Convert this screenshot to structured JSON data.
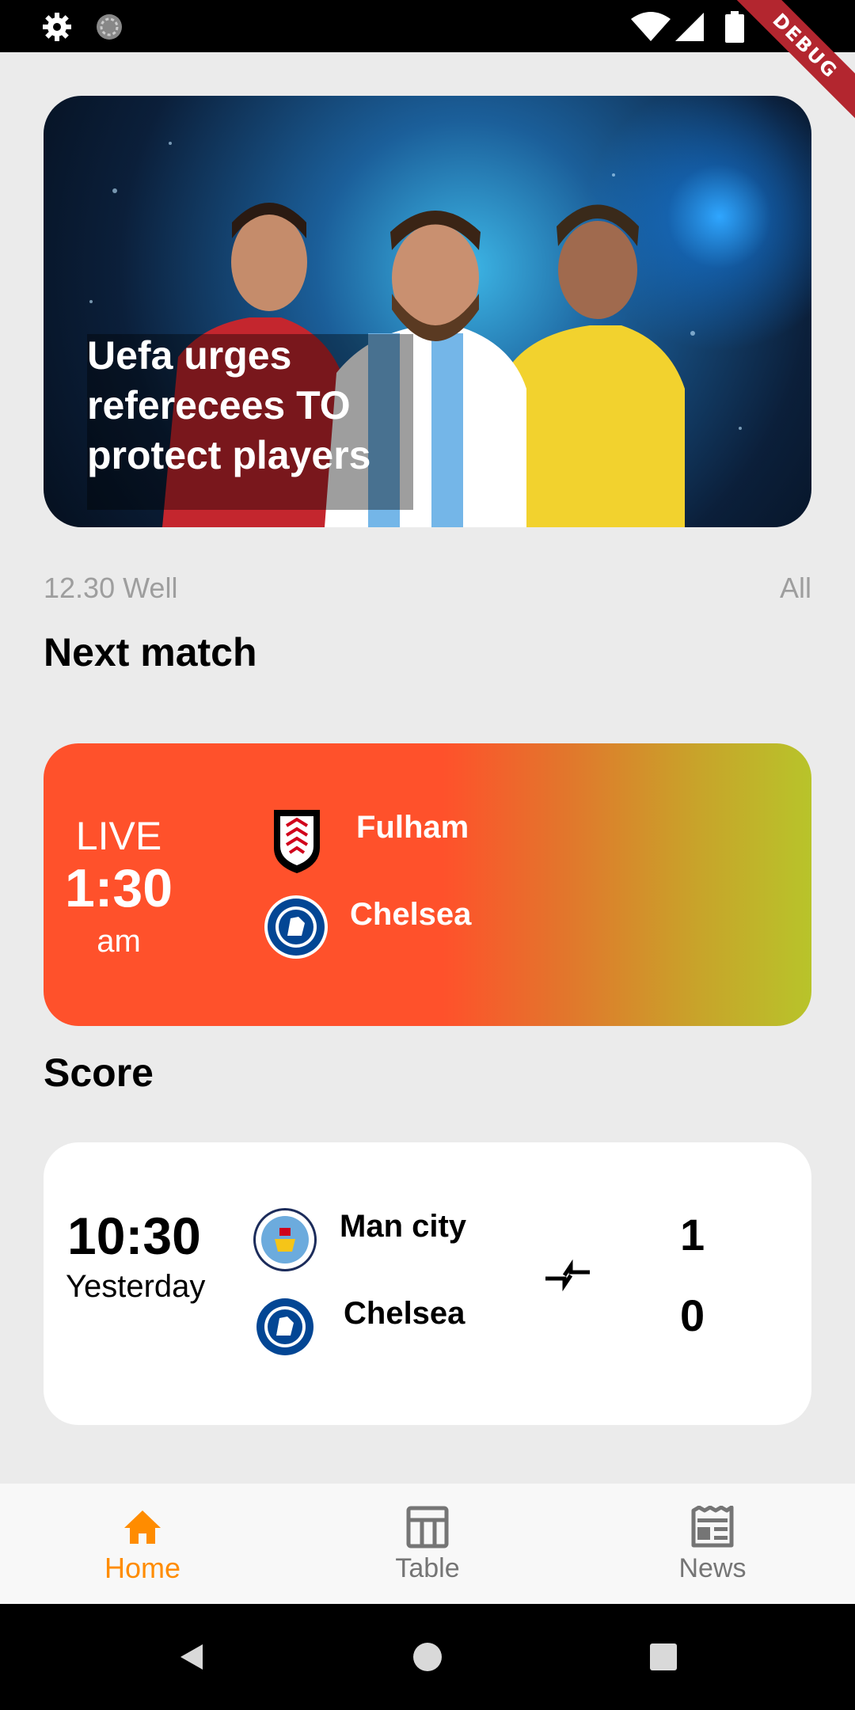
{
  "status_bar": {
    "debug_label": "DEBUG"
  },
  "hero": {
    "title": "Uefa urges referecees TO protect players"
  },
  "meta": {
    "left": "12.30 Well",
    "right": "All"
  },
  "next_match": {
    "section_title": "Next match",
    "status": "LIVE",
    "time": "1:30",
    "ampm": "am",
    "home_team": "Fulham",
    "away_team": "Chelsea",
    "colors": {
      "start": "#ff512b",
      "end": "#b8c42a"
    }
  },
  "score": {
    "section_title": "Score",
    "time": "10:30",
    "day": "Yesterday",
    "home_team": "Man city",
    "away_team": "Chelsea",
    "home_score": "1",
    "away_score": "0"
  },
  "bottom_nav": {
    "items": [
      {
        "label": "Home",
        "icon": "home-icon",
        "active": true
      },
      {
        "label": "Table",
        "icon": "table-icon",
        "active": false
      },
      {
        "label": "News",
        "icon": "news-icon",
        "active": false
      }
    ],
    "active_color": "#ff8c00",
    "inactive_color": "#757575"
  }
}
